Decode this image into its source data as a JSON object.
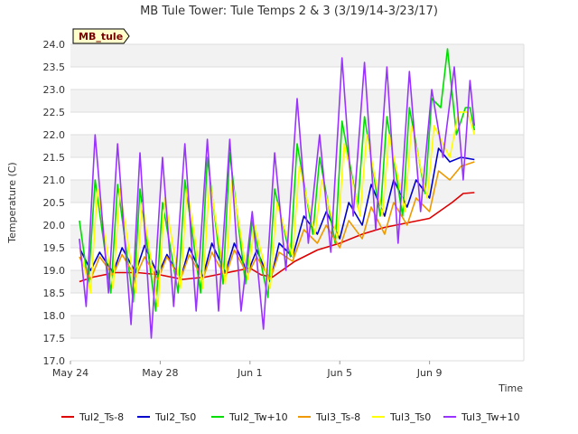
{
  "chart_data": {
    "type": "line",
    "title": "MB Tule Tower: Tule Temps 2 & 3 (3/19/14-3/23/17)",
    "xlabel": "Time",
    "ylabel": "Temperature (C)",
    "annotation": "MB_tule",
    "ylim": [
      17.0,
      24.0
    ],
    "xlim": [
      0,
      20.2
    ],
    "y_ticks": [
      "17.0",
      "17.5",
      "18.0",
      "18.5",
      "19.0",
      "19.5",
      "20.0",
      "20.5",
      "21.0",
      "21.5",
      "22.0",
      "22.5",
      "23.0",
      "23.5",
      "24.0"
    ],
    "x_ticks": [
      {
        "pos": 0,
        "label": "May 24"
      },
      {
        "pos": 4,
        "label": "May 28"
      },
      {
        "pos": 8,
        "label": "Jun 1"
      },
      {
        "pos": 12,
        "label": "Jun 5"
      },
      {
        "pos": 16,
        "label": "Jun 9"
      }
    ],
    "grid": true,
    "legend_position": "bottom",
    "series": [
      {
        "name": "Tul2_Ts-8",
        "color": "#dd0000",
        "x": [
          0.4,
          1,
          2,
          3,
          4,
          5,
          6,
          7,
          8,
          8.5,
          9,
          10,
          11,
          12,
          13,
          14,
          15,
          16,
          17,
          17.5,
          18
        ],
        "y": [
          18.75,
          18.85,
          18.95,
          18.95,
          18.9,
          18.8,
          18.85,
          18.95,
          19.05,
          18.9,
          18.85,
          19.2,
          19.45,
          19.6,
          19.8,
          19.95,
          20.05,
          20.15,
          20.5,
          20.7,
          20.72
        ]
      },
      {
        "name": "Tul2_Ts0",
        "color": "#0000cc",
        "x": [
          0.4,
          0.9,
          1.3,
          1.9,
          2.3,
          2.9,
          3.3,
          3.9,
          4.3,
          4.9,
          5.3,
          5.9,
          6.3,
          6.9,
          7.3,
          7.9,
          8.3,
          8.9,
          9.3,
          9.9,
          10.4,
          11.0,
          11.4,
          12.0,
          12.4,
          13.0,
          13.4,
          14.0,
          14.4,
          15.0,
          15.4,
          16.0,
          16.4,
          16.9,
          17.4,
          18.0
        ],
        "y": [
          19.5,
          19.0,
          19.4,
          18.95,
          19.5,
          18.95,
          19.55,
          18.9,
          19.35,
          18.8,
          19.5,
          18.85,
          19.6,
          18.95,
          19.6,
          18.95,
          19.45,
          18.75,
          19.6,
          19.3,
          20.2,
          19.8,
          20.3,
          19.7,
          20.5,
          20.0,
          20.9,
          20.2,
          21.0,
          20.4,
          21.0,
          20.6,
          21.7,
          21.4,
          21.5,
          21.45
        ]
      },
      {
        "name": "Tul2_Tw+10",
        "color": "#00dd00",
        "x": [
          0.4,
          0.8,
          1.1,
          1.8,
          2.1,
          2.8,
          3.1,
          3.8,
          4.1,
          4.8,
          5.1,
          5.8,
          6.1,
          6.8,
          7.1,
          7.8,
          8.1,
          8.8,
          9.1,
          9.8,
          10.1,
          10.8,
          11.1,
          11.8,
          12.1,
          12.8,
          13.1,
          13.8,
          14.1,
          14.8,
          15.1,
          15.8,
          16.1,
          16.5,
          16.8,
          17.2,
          17.6,
          17.8,
          18.0
        ],
        "y": [
          20.1,
          18.7,
          21.0,
          18.5,
          20.9,
          18.3,
          20.8,
          18.1,
          20.5,
          18.5,
          21.0,
          18.5,
          21.5,
          18.7,
          21.6,
          18.7,
          20.1,
          18.4,
          20.8,
          19.3,
          21.8,
          19.8,
          21.5,
          19.6,
          22.3,
          20.4,
          22.4,
          20.2,
          22.4,
          20.2,
          22.6,
          20.7,
          22.8,
          22.6,
          23.9,
          22.0,
          22.6,
          22.6,
          22.1
        ]
      },
      {
        "name": "Tul3_Ts-8",
        "color": "#ee9900",
        "x": [
          0.4,
          0.9,
          1.3,
          1.9,
          2.3,
          2.9,
          3.3,
          3.9,
          4.3,
          4.9,
          5.3,
          5.9,
          6.3,
          6.9,
          7.3,
          7.9,
          8.3,
          8.9,
          9.3,
          9.9,
          10.4,
          11.0,
          11.4,
          12.0,
          12.4,
          13.0,
          13.4,
          14.0,
          14.4,
          15.0,
          15.4,
          16.0,
          16.4,
          16.9,
          17.4,
          18.0
        ],
        "y": [
          19.3,
          18.8,
          19.3,
          18.9,
          19.35,
          18.85,
          19.3,
          18.8,
          19.3,
          18.8,
          19.35,
          18.8,
          19.4,
          18.85,
          19.45,
          18.9,
          19.3,
          18.8,
          19.4,
          19.2,
          19.9,
          19.6,
          20.0,
          19.5,
          20.1,
          19.7,
          20.4,
          19.8,
          20.5,
          20.0,
          20.6,
          20.3,
          21.2,
          21.0,
          21.3,
          21.4
        ]
      },
      {
        "name": "Tul3_Ts0",
        "color": "#ffff00",
        "x": [
          0.4,
          0.9,
          1.2,
          1.9,
          2.2,
          2.9,
          3.2,
          3.9,
          4.2,
          4.9,
          5.2,
          5.9,
          6.2,
          6.9,
          7.2,
          7.9,
          8.2,
          8.9,
          9.2,
          9.9,
          10.2,
          10.9,
          11.2,
          11.9,
          12.2,
          12.9,
          13.2,
          13.9,
          14.2,
          14.9,
          15.2,
          15.9,
          16.2,
          16.9,
          17.3,
          17.7,
          18.0
        ],
        "y": [
          19.5,
          18.5,
          20.8,
          18.6,
          20.8,
          18.5,
          20.5,
          18.2,
          20.6,
          18.6,
          20.8,
          18.6,
          21.0,
          18.7,
          21.0,
          18.8,
          20.0,
          18.6,
          20.5,
          19.3,
          21.3,
          19.8,
          21.0,
          19.7,
          21.8,
          20.2,
          22.0,
          20.2,
          22.0,
          20.3,
          22.2,
          20.6,
          22.2,
          21.5,
          22.5,
          22.5,
          22.0
        ]
      },
      {
        "name": "Tul3_Tw+10",
        "color": "#9933ff",
        "x": [
          0.4,
          0.7,
          1.1,
          1.7,
          2.1,
          2.7,
          3.1,
          3.6,
          4.1,
          4.6,
          5.1,
          5.6,
          6.1,
          6.6,
          7.1,
          7.6,
          8.1,
          8.6,
          9.1,
          9.6,
          10.1,
          10.6,
          11.1,
          11.6,
          12.1,
          12.6,
          13.1,
          13.6,
          14.1,
          14.6,
          15.1,
          15.6,
          16.1,
          16.6,
          17.1,
          17.5,
          17.8,
          18.0
        ],
        "y": [
          19.7,
          18.2,
          22.0,
          18.5,
          21.8,
          17.8,
          21.6,
          17.5,
          21.5,
          18.2,
          21.8,
          18.1,
          21.9,
          18.1,
          21.9,
          18.1,
          20.3,
          17.7,
          21.6,
          19.0,
          22.8,
          19.6,
          22.0,
          19.4,
          23.7,
          20.2,
          23.6,
          19.9,
          23.5,
          19.6,
          23.4,
          20.3,
          23.0,
          21.5,
          23.5,
          21.0,
          23.2,
          22.2
        ]
      }
    ]
  }
}
